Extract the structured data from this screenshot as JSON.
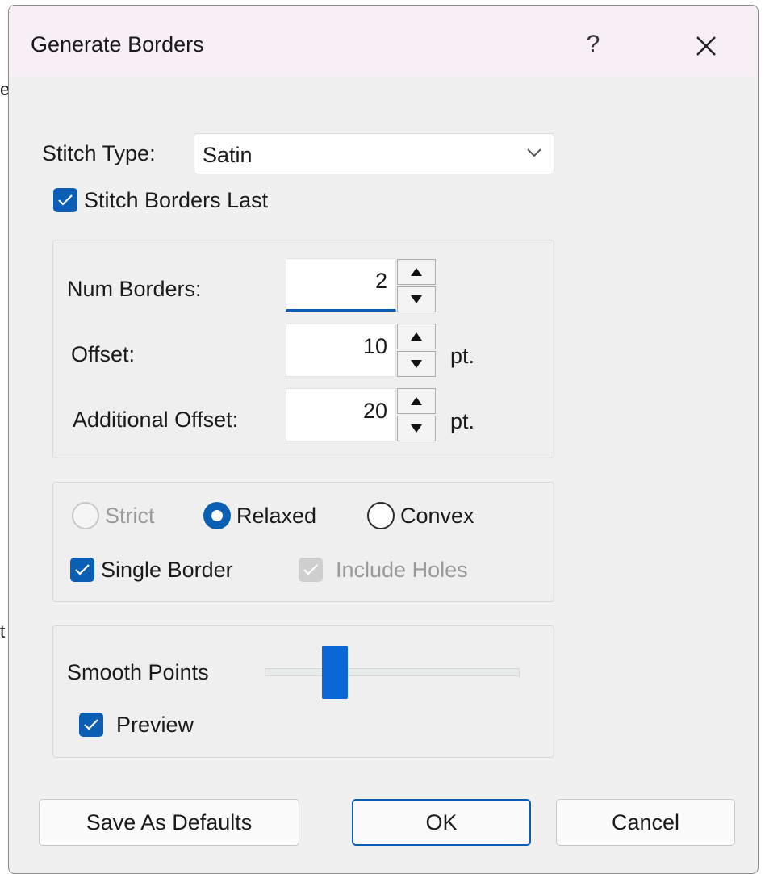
{
  "background": {
    "fragment_top": "e",
    "fragment_mid": "t"
  },
  "dialog": {
    "title": "Generate Borders",
    "help_label": "?",
    "stitch_type": {
      "label": "Stitch Type:",
      "value": "Satin"
    },
    "stitch_borders_last": {
      "label": "Stitch Borders Last",
      "checked": true
    },
    "borders_group": {
      "num_borders": {
        "label": "Num Borders:",
        "value": "2"
      },
      "offset": {
        "label": "Offset:",
        "value": "10",
        "unit": "pt."
      },
      "additional_offset": {
        "label": "Additional Offset:",
        "value": "20",
        "unit": "pt."
      }
    },
    "mode_group": {
      "strict": {
        "label": "Strict",
        "selected": false,
        "enabled": false
      },
      "relaxed": {
        "label": "Relaxed",
        "selected": true,
        "enabled": true
      },
      "convex": {
        "label": "Convex",
        "selected": false,
        "enabled": true
      },
      "single_border": {
        "label": "Single Border",
        "checked": true,
        "enabled": true
      },
      "include_holes": {
        "label": "Include Holes",
        "checked": true,
        "enabled": false
      }
    },
    "smooth_group": {
      "smooth_points": {
        "label": "Smooth Points",
        "level": 0.25
      },
      "preview": {
        "label": "Preview",
        "checked": true
      }
    },
    "buttons": {
      "save_defaults": "Save As Defaults",
      "ok": "OK",
      "cancel": "Cancel"
    }
  },
  "colors": {
    "accent": "#0a5fb5",
    "title_bar": "#f7eff5",
    "dialog_bg": "#f0f0f0"
  }
}
